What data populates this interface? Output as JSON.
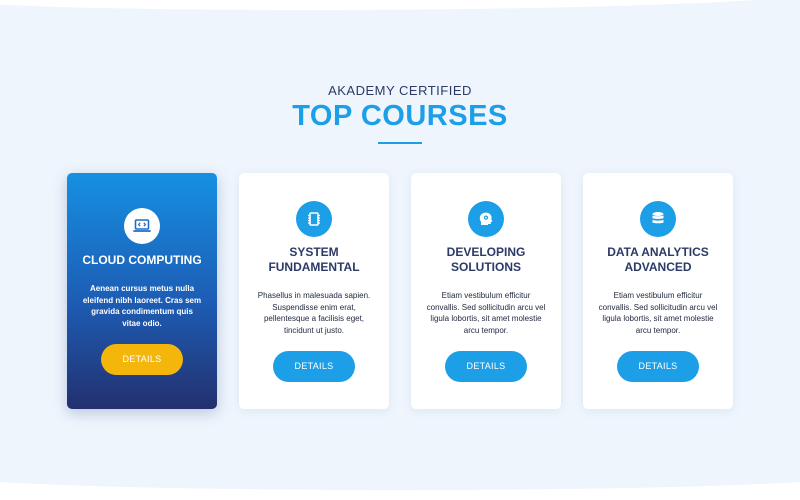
{
  "section": {
    "eyebrow": "AKADEMY CERTIFIED",
    "title": "TOP COURSES"
  },
  "colors": {
    "accent": "#1d9fe8",
    "navy": "#2b3a67",
    "featured_button": "#f5b60c",
    "background": "#eef5fd"
  },
  "courses": [
    {
      "title": "CLOUD COMPUTING",
      "description": "Aenean cursus metus nulla eleifend nibh laoreet. Cras sem gravida condimentum quis vitae odio.",
      "button": "DETAILS",
      "icon": "laptop-code-icon",
      "featured": true
    },
    {
      "title": "SYSTEM FUNDAMENTAL",
      "description": "Phasellus in malesuada sapien. Suspendisse enim erat, pellentesque a facilisis eget, tincidunt ut justo.",
      "button": "DETAILS",
      "icon": "chip-icon",
      "featured": false
    },
    {
      "title": "DEVELOPING SOLUTIONS",
      "description": "Etiam vestibulum efficitur convallis. Sed sollicitudin arcu vel ligula lobortis, sit amet molestie arcu tempor.",
      "button": "DETAILS",
      "icon": "head-gear-icon",
      "featured": false
    },
    {
      "title": "DATA ANALYTICS ADVANCED",
      "description": "Etiam vestibulum efficitur convallis. Sed sollicitudin arcu vel ligula lobortis, sit amet molestie arcu tempor.",
      "button": "DETAILS",
      "icon": "database-icon",
      "featured": false
    }
  ]
}
